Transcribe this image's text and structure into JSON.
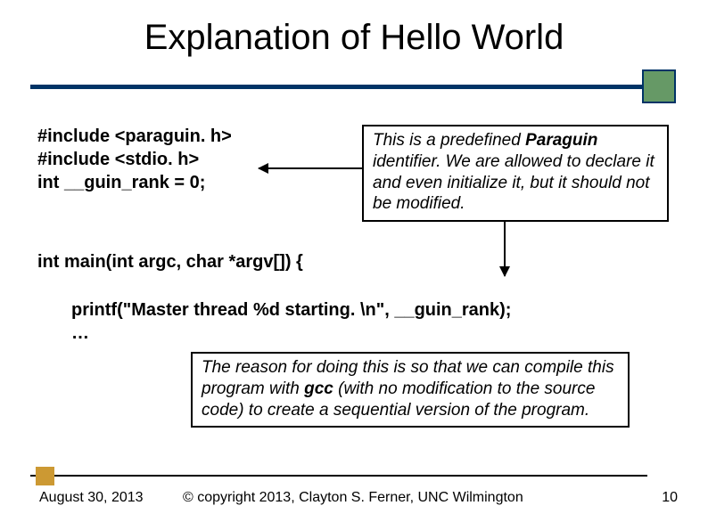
{
  "title": "Explanation of Hello World",
  "code1_line1": "#include <paraguin. h>",
  "code1_line2": "#include <stdio. h>",
  "code1_line3": "int __guin_rank = 0;",
  "callout1_pre": "This is a predefined ",
  "callout1_bold": "Paraguin",
  "callout1_post": " identifier. We are allowed to declare it and even initialize it, but it should not be modified.",
  "code2": "int main(int argc, char *argv[]) {",
  "code3_line1": "printf(\"Master thread %d starting. \\n\", __guin_rank);",
  "code3_line2": "…",
  "callout2_pre": "The reason for doing this is so that we can compile this program with ",
  "callout2_bold": "gcc",
  "callout2_post": " (with no modification to the source code) to create a sequential version of the program.",
  "date": "August 30, 2013",
  "copyright": "© copyright 2013, Clayton S. Ferner, UNC Wilmington",
  "pagenum": "10"
}
